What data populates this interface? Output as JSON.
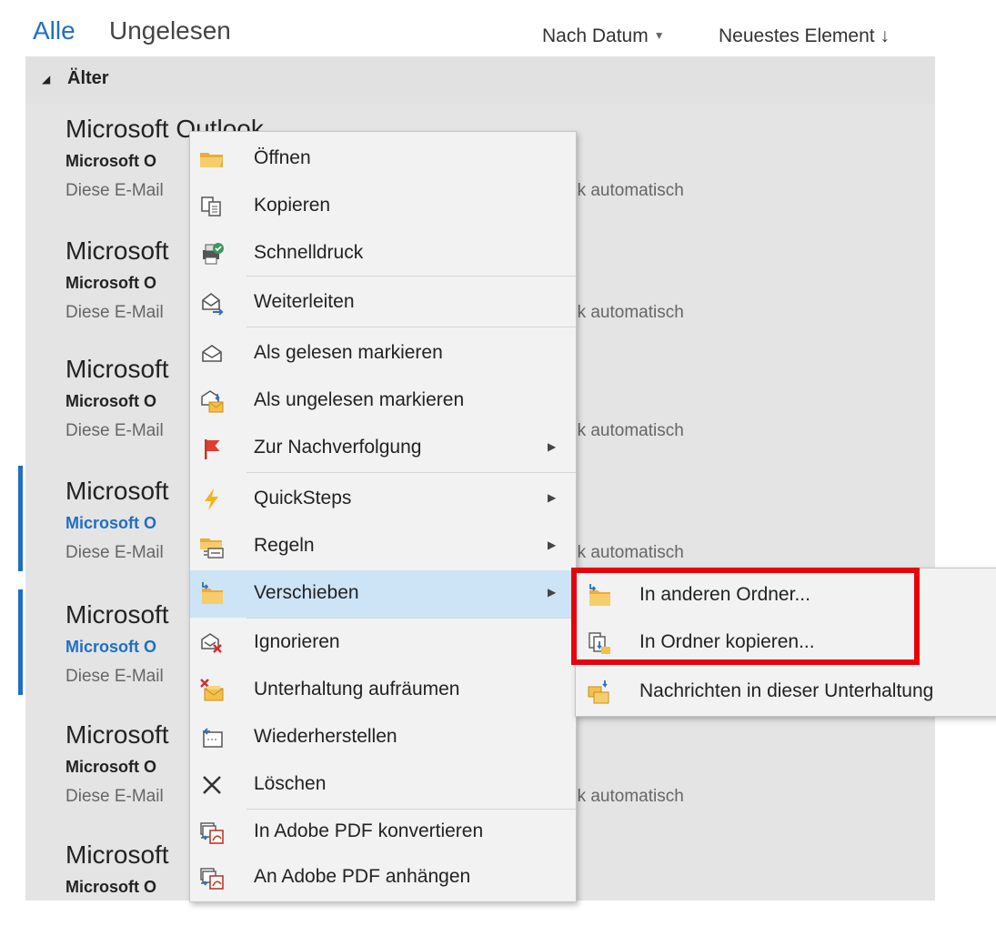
{
  "header": {
    "tabs": [
      {
        "label": "Alle",
        "active": true
      },
      {
        "label": "Ungelesen",
        "active": false
      }
    ],
    "sort_by": "Nach Datum",
    "sort_order": "Neuestes Element",
    "sort_order_arrow": "↓"
  },
  "group": {
    "label": "Älter"
  },
  "mails": [
    {
      "title": "Microsoft Outlook",
      "sender": "Microsoft O",
      "preview": "Diese E-Mail",
      "preview_tail": "ok automatisch",
      "unread": false
    },
    {
      "title": "Microsoft",
      "sender": "Microsoft O",
      "preview": "Diese E-Mail",
      "preview_tail": "ok automatisch",
      "unread": false
    },
    {
      "title": "Microsoft",
      "sender": "Microsoft O",
      "preview": "Diese E-Mail",
      "preview_tail": "ok automatisch",
      "unread": false
    },
    {
      "title": "Microsoft",
      "sender": "Microsoft O",
      "preview": "Diese E-Mail",
      "preview_tail": "ok automatisch",
      "unread": true
    },
    {
      "title": "Microsoft",
      "sender": "Microsoft O",
      "preview": "Diese E-Mail",
      "preview_tail": "",
      "unread": true
    },
    {
      "title": "Microsoft",
      "sender": "Microsoft O",
      "preview": "Diese E-Mail",
      "preview_tail": "ok automatisch",
      "unread": false
    },
    {
      "title": "Microsoft",
      "sender": "Microsoft O",
      "preview": "",
      "preview_tail": "",
      "unread": false
    }
  ],
  "context_menu": {
    "items": [
      {
        "label": "Öffnen",
        "icon": "folder-open-icon",
        "has_submenu": false
      },
      {
        "label": "Kopieren",
        "icon": "copy-icon",
        "has_submenu": false
      },
      {
        "label": "Schnelldruck",
        "icon": "quick-print-icon",
        "has_submenu": false
      },
      {
        "label": "Weiterleiten",
        "icon": "forward-icon",
        "has_submenu": false
      },
      {
        "label": "Als gelesen markieren",
        "icon": "envelope-open-icon",
        "has_submenu": false
      },
      {
        "label": "Als ungelesen markieren",
        "icon": "envelope-unread-icon",
        "has_submenu": false
      },
      {
        "label": "Zur Nachverfolgung",
        "icon": "flag-icon",
        "has_submenu": true
      },
      {
        "label": "QuickSteps",
        "icon": "lightning-icon",
        "has_submenu": true
      },
      {
        "label": "Regeln",
        "icon": "rules-icon",
        "has_submenu": true
      },
      {
        "label": "Verschieben",
        "icon": "move-folder-icon",
        "has_submenu": true,
        "highlighted": true
      },
      {
        "label": "Ignorieren",
        "icon": "ignore-icon",
        "has_submenu": false
      },
      {
        "label": "Unterhaltung aufräumen",
        "icon": "cleanup-icon",
        "has_submenu": false
      },
      {
        "label": "Wiederherstellen",
        "icon": "restore-icon",
        "has_submenu": false
      },
      {
        "label": "Löschen",
        "icon": "delete-x-icon",
        "has_submenu": false
      },
      {
        "label": "In Adobe PDF konvertieren",
        "icon": "pdf-convert-icon",
        "has_submenu": false
      },
      {
        "label": "An Adobe PDF anhängen",
        "icon": "pdf-append-icon",
        "has_submenu": false
      }
    ]
  },
  "submenu": {
    "items": [
      {
        "label": "In anderen Ordner...",
        "icon": "move-to-folder-icon"
      },
      {
        "label": "In Ordner kopieren...",
        "icon": "copy-to-folder-icon"
      },
      {
        "label": "Nachrichten in dieser Unterhaltung",
        "icon": "move-conversation-icon"
      }
    ]
  },
  "colors": {
    "accent": "#1e6fc5",
    "menu_highlight": "#cde4f7",
    "annotation_red": "#e8000b",
    "folder_yellow": "#f4c04a"
  }
}
